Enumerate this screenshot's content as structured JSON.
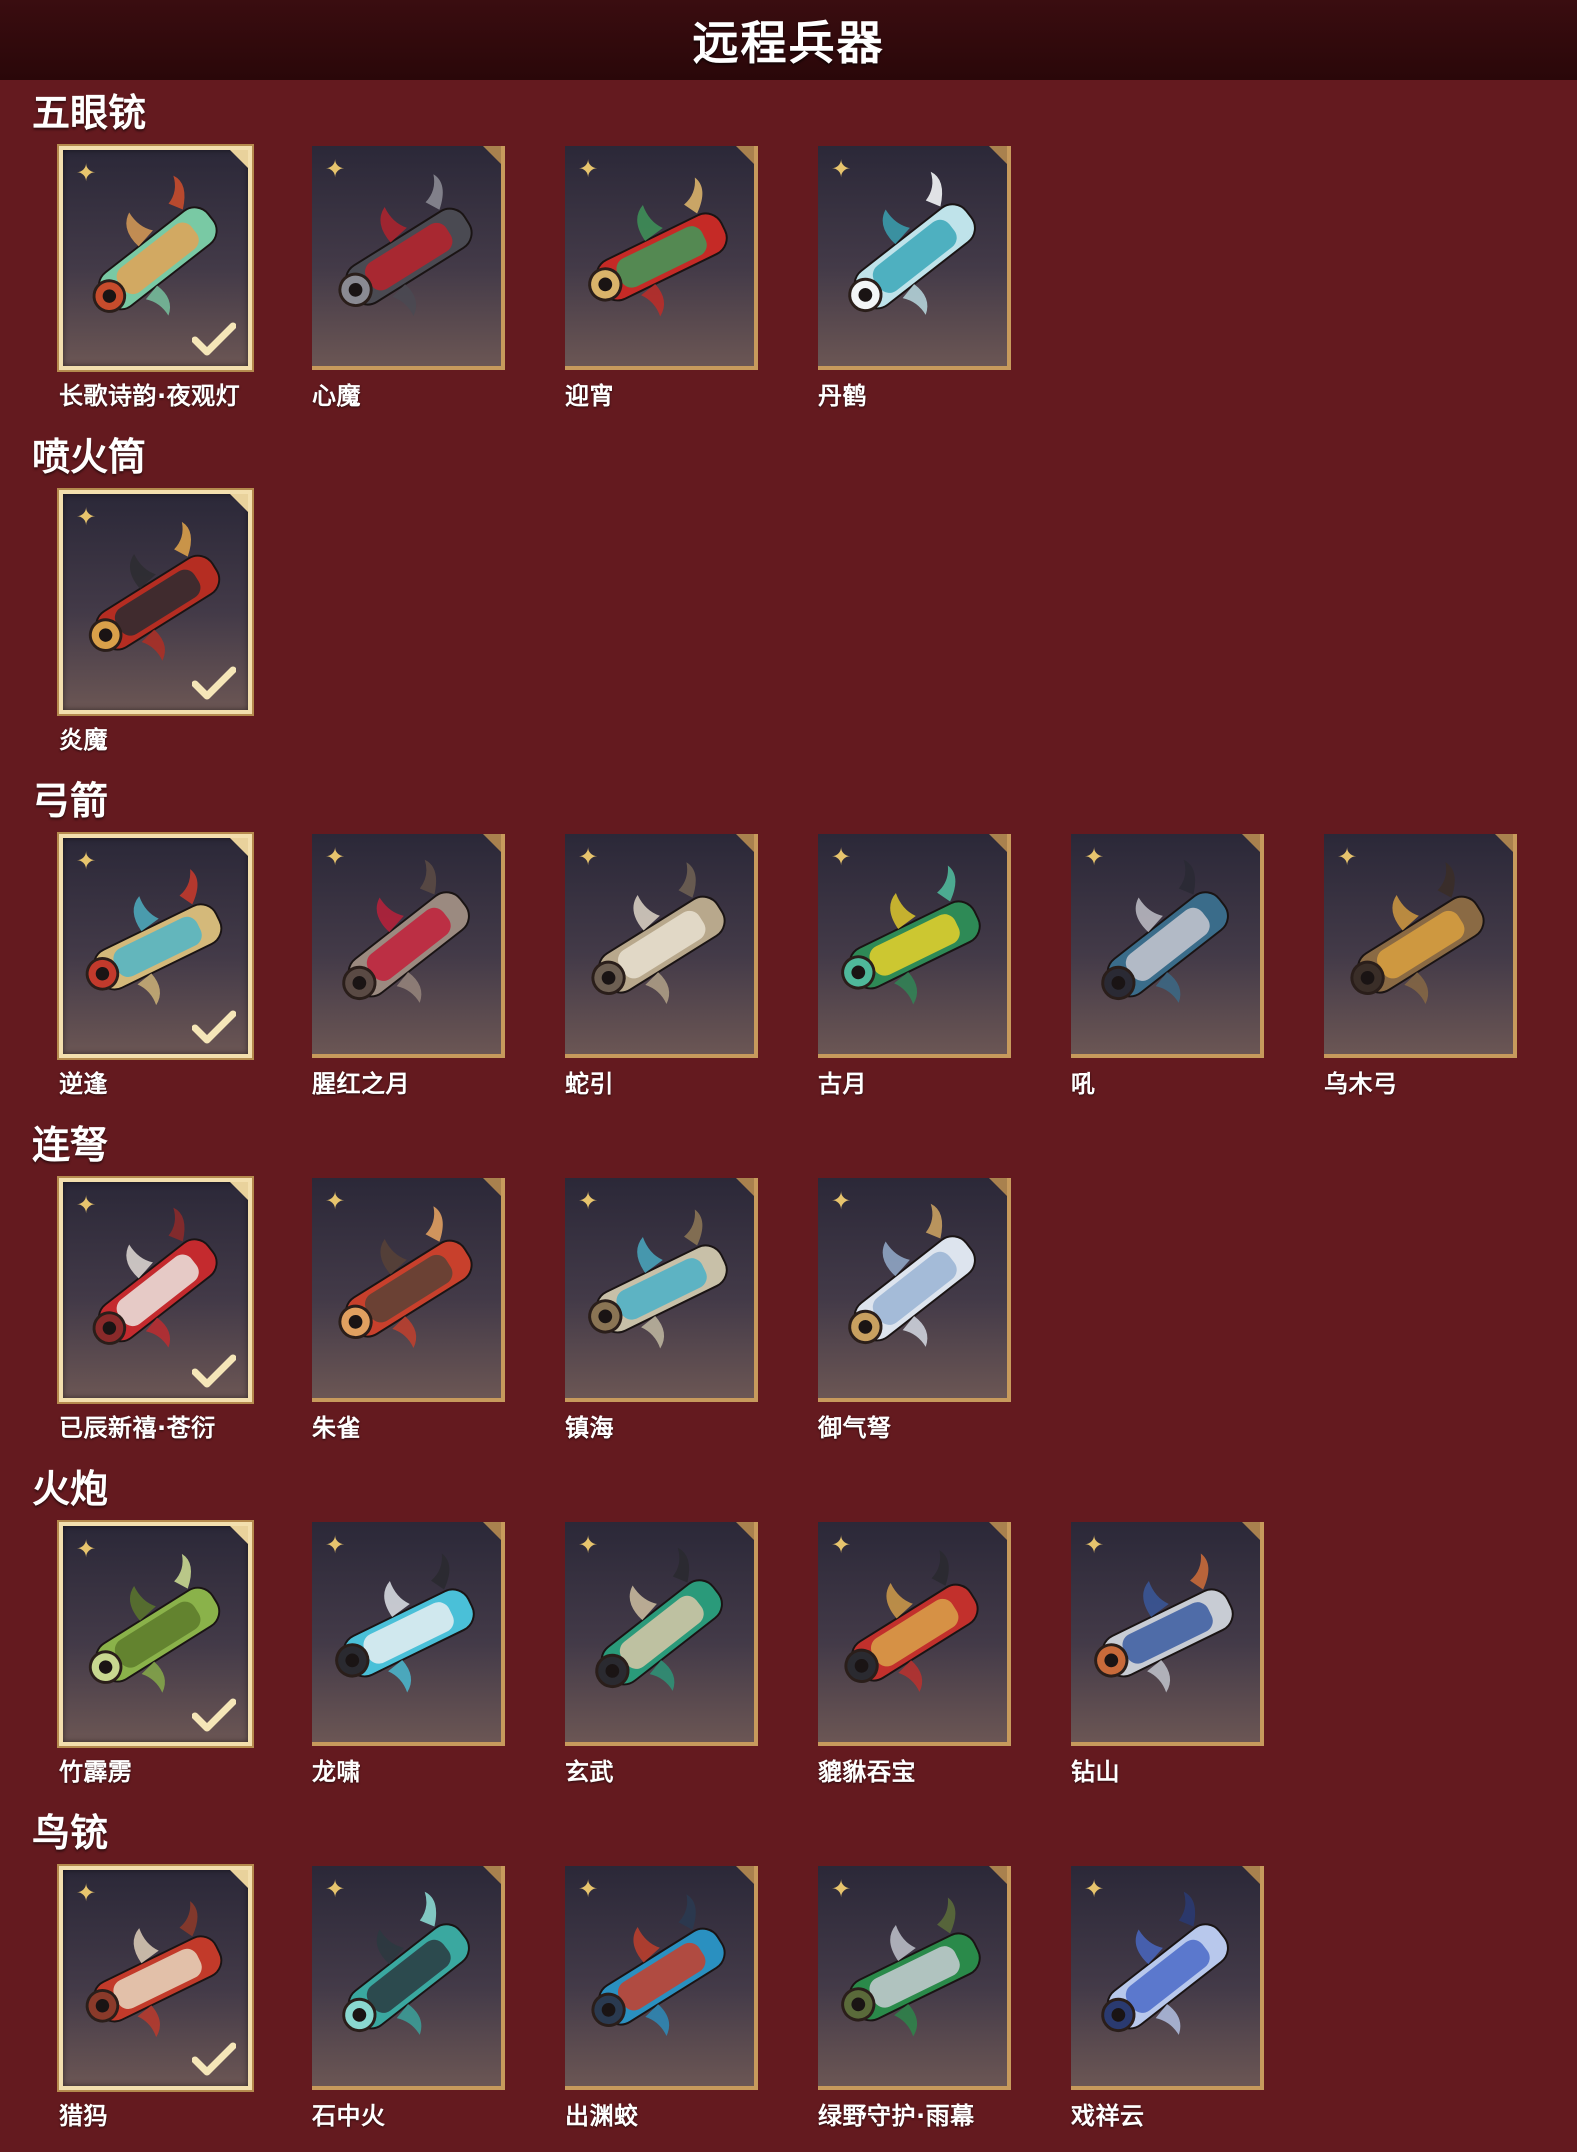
{
  "header": {
    "title": "远程兵器"
  },
  "sections": [
    {
      "title": "五眼铳",
      "items": [
        {
          "name": "长歌诗韵·夜观灯",
          "selected": true,
          "colors": [
            "#79c9a4",
            "#e2a357",
            "#c64c2c"
          ]
        },
        {
          "name": "心魔",
          "selected": false,
          "colors": [
            "#4a4a52",
            "#b8222c",
            "#8a8a92"
          ]
        },
        {
          "name": "迎宵",
          "selected": false,
          "colors": [
            "#c52a26",
            "#3f9a5a",
            "#d9b36a"
          ]
        },
        {
          "name": "丹鹤",
          "selected": false,
          "colors": [
            "#bfe3ea",
            "#3aa7b8",
            "#f3f6f7"
          ]
        }
      ]
    },
    {
      "title": "喷火筒",
      "items": [
        {
          "name": "炎魔",
          "selected": true,
          "colors": [
            "#b52d22",
            "#2c2c30",
            "#d9a04a"
          ]
        }
      ]
    },
    {
      "title": "弓箭",
      "items": [
        {
          "name": "逆逢",
          "selected": true,
          "colors": [
            "#d4b97a",
            "#4fb5c8",
            "#c23a2c"
          ]
        },
        {
          "name": "腥红之月",
          "selected": false,
          "colors": [
            "#9b8a80",
            "#c21f3a",
            "#5a4a44"
          ]
        },
        {
          "name": "蛇引",
          "selected": false,
          "colors": [
            "#b8a88c",
            "#e8e0d0",
            "#6d5f52"
          ]
        },
        {
          "name": "古月",
          "selected": false,
          "colors": [
            "#2e8a56",
            "#e8d12a",
            "#4fb89a"
          ]
        },
        {
          "name": "吼",
          "selected": false,
          "colors": [
            "#3a6c8a",
            "#c8c8d0",
            "#2a2a34"
          ]
        },
        {
          "name": "乌木弓",
          "selected": false,
          "colors": [
            "#8a6a44",
            "#d9a040",
            "#3a2e28"
          ]
        }
      ]
    },
    {
      "title": "连弩",
      "items": [
        {
          "name": "已辰新禧·苍衍",
          "selected": true,
          "colors": [
            "#c42a2e",
            "#ece6e0",
            "#8a2a2a"
          ]
        },
        {
          "name": "朱雀",
          "selected": false,
          "colors": [
            "#c8402c",
            "#5a4236",
            "#e0a060"
          ]
        },
        {
          "name": "镇海",
          "selected": false,
          "colors": [
            "#c8c0a8",
            "#4ab0c8",
            "#8a7454"
          ]
        },
        {
          "name": "御气弩",
          "selected": false,
          "colors": [
            "#dde4ee",
            "#9ab4d4",
            "#c8a060"
          ]
        }
      ]
    },
    {
      "title": "火炮",
      "items": [
        {
          "name": "竹霹雳",
          "selected": true,
          "colors": [
            "#8ab24a",
            "#5c7a2a",
            "#c8d890"
          ]
        },
        {
          "name": "龙啸",
          "selected": false,
          "colors": [
            "#4ac0d8",
            "#e8eef2",
            "#2a2a30"
          ]
        },
        {
          "name": "玄武",
          "selected": false,
          "colors": [
            "#2a9a7a",
            "#d8c8a8",
            "#2a2a30"
          ]
        },
        {
          "name": "貔貅吞宝",
          "selected": false,
          "colors": [
            "#c2302c",
            "#d9a24a",
            "#2a2a30"
          ]
        },
        {
          "name": "钻山",
          "selected": false,
          "colors": [
            "#c8ccd4",
            "#3a5aa0",
            "#c86a3a"
          ]
        }
      ]
    },
    {
      "title": "鸟铳",
      "items": [
        {
          "name": "猎犸",
          "selected": true,
          "colors": [
            "#c23a2a",
            "#e8d8c0",
            "#8a3a2a"
          ]
        },
        {
          "name": "石中火",
          "selected": false,
          "colors": [
            "#3aa8a0",
            "#2a3a40",
            "#8ad8d0"
          ]
        },
        {
          "name": "出渊蛟",
          "selected": false,
          "colors": [
            "#2a90c0",
            "#c8402a",
            "#2a3a50"
          ]
        },
        {
          "name": "绿野守护·雨幕",
          "selected": false,
          "colors": [
            "#2a8a4a",
            "#c8ccd4",
            "#5a6a3a"
          ]
        },
        {
          "name": "戏祥云",
          "selected": false,
          "colors": [
            "#b8c8ec",
            "#4a6ac8",
            "#2a3a70"
          ]
        }
      ]
    }
  ],
  "icons": {
    "rank": "four-point-star-icon",
    "equipped": "checkmark-icon"
  },
  "theme": {
    "background": "#641a1f",
    "header": "#2a0709",
    "card_border": "#c79a5c",
    "selected_border": "#f3dfae",
    "rank_icon": "#e7c46d"
  }
}
